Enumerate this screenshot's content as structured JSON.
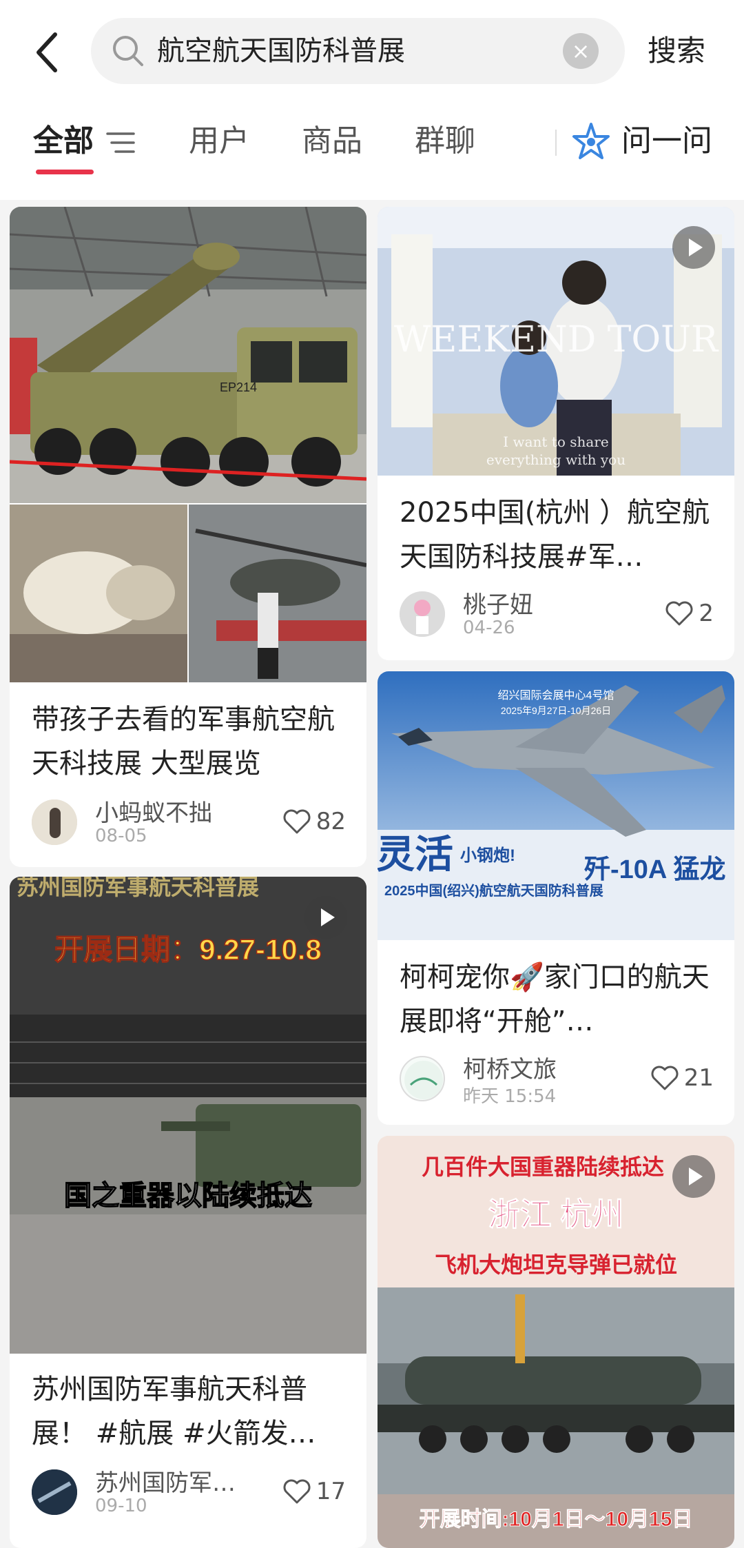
{
  "search": {
    "query": "航空航天国防科普展",
    "clear_label": "×",
    "button_label": "搜索"
  },
  "tabs": {
    "items": [
      "全部",
      "用户",
      "商品",
      "群聊"
    ],
    "ask_label": "问一问",
    "active_color": "#e8334a"
  },
  "cards": [
    {
      "title": "带孩子去看的军事航空航天科技展 大型展览",
      "author": "小蚂蚁不拙",
      "date": "08-05",
      "likes": "82",
      "image_text": "EP214"
    },
    {
      "title": "2025中国(杭州 ）航空航天国防科技展#军…",
      "author": "桃子妞",
      "date": "04-26",
      "likes": "2",
      "image_text": [
        "WEEKEND TOUR",
        "I want to share",
        "everything with you"
      ]
    },
    {
      "title": "柯柯宠你🚀家门口的航天展即将“开舱”…",
      "author": "柯桥文旅",
      "date": "昨天 15:54",
      "likes": "21",
      "image_text": [
        "绍兴国际会展中心4号馆",
        "2025年9月27日-10月26日",
        "灵活",
        "小钢炮!",
        "歼-10A 猛龙",
        "2025中国(绍兴)航空航天国防科普展"
      ]
    },
    {
      "title": "苏州国防军事航天科普展！ #航展 #火箭发…",
      "author": "苏州国防军…",
      "date": "09-10",
      "likes": "17",
      "image_text": [
        "苏州国防军事航天科普展",
        "开展日期：9.27-10.8",
        "国之重器以陆续抵达"
      ]
    },
    {
      "image_text": [
        "几百件大国重器陆续抵达",
        "浙江 杭州",
        "飞机大炮坦克导弹已就位",
        "开展时间:10月1日～10月15日"
      ]
    }
  ]
}
